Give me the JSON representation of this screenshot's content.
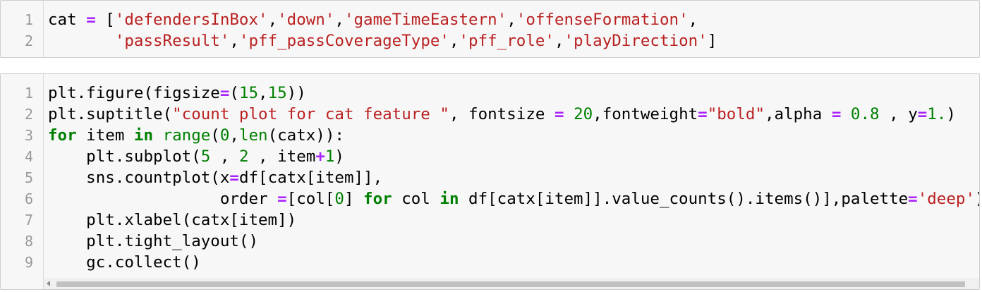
{
  "cell1": {
    "line_numbers": [
      "1",
      "2"
    ],
    "lines": [
      [
        {
          "t": "cat ",
          "c": "plain"
        },
        {
          "t": "=",
          "c": "op"
        },
        {
          "t": " [",
          "c": "plain"
        },
        {
          "t": "'defendersInBox'",
          "c": "str"
        },
        {
          "t": ",",
          "c": "plain"
        },
        {
          "t": "'down'",
          "c": "str"
        },
        {
          "t": ",",
          "c": "plain"
        },
        {
          "t": "'gameTimeEastern'",
          "c": "str"
        },
        {
          "t": ",",
          "c": "plain"
        },
        {
          "t": "'offenseFormation'",
          "c": "str"
        },
        {
          "t": ",",
          "c": "plain"
        }
      ],
      [
        {
          "t": "       ",
          "c": "plain"
        },
        {
          "t": "'passResult'",
          "c": "str"
        },
        {
          "t": ",",
          "c": "plain"
        },
        {
          "t": "'pff_passCoverageType'",
          "c": "str"
        },
        {
          "t": ",",
          "c": "plain"
        },
        {
          "t": "'pff_role'",
          "c": "str"
        },
        {
          "t": ",",
          "c": "plain"
        },
        {
          "t": "'playDirection'",
          "c": "str"
        },
        {
          "t": "]",
          "c": "plain"
        }
      ]
    ]
  },
  "cell2": {
    "line_numbers": [
      "1",
      "2",
      "3",
      "4",
      "5",
      "6",
      "7",
      "8",
      "9"
    ],
    "lines": [
      [
        {
          "t": "plt.figure(figsize",
          "c": "plain"
        },
        {
          "t": "=",
          "c": "op"
        },
        {
          "t": "(",
          "c": "plain"
        },
        {
          "t": "15",
          "c": "num"
        },
        {
          "t": ",",
          "c": "plain"
        },
        {
          "t": "15",
          "c": "num"
        },
        {
          "t": "))",
          "c": "plain"
        }
      ],
      [
        {
          "t": "plt.suptitle(",
          "c": "plain"
        },
        {
          "t": "\"count plot for cat feature \"",
          "c": "str"
        },
        {
          "t": ", fontsize ",
          "c": "plain"
        },
        {
          "t": "=",
          "c": "op"
        },
        {
          "t": " ",
          "c": "plain"
        },
        {
          "t": "20",
          "c": "num"
        },
        {
          "t": ",fontweight",
          "c": "plain"
        },
        {
          "t": "=",
          "c": "op"
        },
        {
          "t": "\"bold\"",
          "c": "str"
        },
        {
          "t": ",alpha ",
          "c": "plain"
        },
        {
          "t": "=",
          "c": "op"
        },
        {
          "t": " ",
          "c": "plain"
        },
        {
          "t": "0.8",
          "c": "num"
        },
        {
          "t": " , y",
          "c": "plain"
        },
        {
          "t": "=",
          "c": "op"
        },
        {
          "t": "1.",
          "c": "num"
        },
        {
          "t": ")",
          "c": "plain"
        }
      ],
      [
        {
          "t": "for",
          "c": "kw"
        },
        {
          "t": " item ",
          "c": "plain"
        },
        {
          "t": "in",
          "c": "kw"
        },
        {
          "t": " ",
          "c": "plain"
        },
        {
          "t": "range",
          "c": "bi"
        },
        {
          "t": "(",
          "c": "plain"
        },
        {
          "t": "0",
          "c": "num"
        },
        {
          "t": ",",
          "c": "plain"
        },
        {
          "t": "len",
          "c": "bi"
        },
        {
          "t": "(catx)):",
          "c": "plain"
        }
      ],
      [
        {
          "t": "    plt.subplot(",
          "c": "plain"
        },
        {
          "t": "5",
          "c": "num"
        },
        {
          "t": " , ",
          "c": "plain"
        },
        {
          "t": "2",
          "c": "num"
        },
        {
          "t": " , item",
          "c": "plain"
        },
        {
          "t": "+",
          "c": "op"
        },
        {
          "t": "1",
          "c": "num"
        },
        {
          "t": ")",
          "c": "plain"
        }
      ],
      [
        {
          "t": "    sns.countplot(x",
          "c": "plain"
        },
        {
          "t": "=",
          "c": "op"
        },
        {
          "t": "df[catx[item]],",
          "c": "plain"
        }
      ],
      [
        {
          "t": "                  order ",
          "c": "plain"
        },
        {
          "t": "=",
          "c": "op"
        },
        {
          "t": "[col[",
          "c": "plain"
        },
        {
          "t": "0",
          "c": "num"
        },
        {
          "t": "] ",
          "c": "plain"
        },
        {
          "t": "for",
          "c": "kw"
        },
        {
          "t": " col ",
          "c": "plain"
        },
        {
          "t": "in",
          "c": "kw"
        },
        {
          "t": " df[catx[item]].value_counts().items()],palette",
          "c": "plain"
        },
        {
          "t": "=",
          "c": "op"
        },
        {
          "t": "'deep'",
          "c": "str"
        },
        {
          "t": ")",
          "c": "plain"
        }
      ],
      [
        {
          "t": "    plt.xlabel(catx[item])",
          "c": "plain"
        }
      ],
      [
        {
          "t": "    plt.tight_layout()",
          "c": "plain"
        }
      ],
      [
        {
          "t": "    gc.collect()",
          "c": "plain"
        }
      ]
    ]
  },
  "colors": {
    "keyword": "#008000",
    "string": "#ba2121",
    "operator": "#aa22ff",
    "number": "#008000",
    "cell_background": "#f7f7f7",
    "cell_border": "#cfcfcf",
    "line_number": "#999999"
  },
  "icons": {
    "scroll_left": "triangle-left-icon"
  }
}
